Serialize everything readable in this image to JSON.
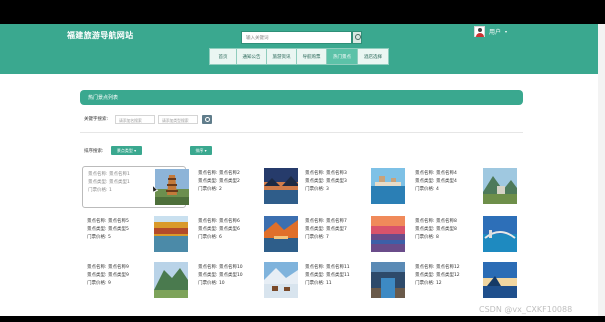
{
  "header": {
    "site_title": "福建旅游导航网站",
    "search_placeholder": "输入关键词",
    "user_name": "用户",
    "user_caret": "▾"
  },
  "nav": [
    {
      "label": "首页",
      "active": false,
      "w": 27
    },
    {
      "label": "通知公告",
      "active": false,
      "w": 30
    },
    {
      "label": "旅游资讯",
      "active": false,
      "w": 30
    },
    {
      "label": "导航购票",
      "active": false,
      "w": 30
    },
    {
      "label": "热门景点",
      "active": true,
      "w": 31
    },
    {
      "label": "酒店选择",
      "active": false,
      "w": 30
    }
  ],
  "panel": {
    "title": "热门景点列表",
    "keyword_label": "关键字搜索:",
    "name_placeholder": "请添加名搜索",
    "type_placeholder": "请添加类型搜索",
    "sort_label": "排序搜索:",
    "sort_type_button": "景点类型 ▾",
    "sort_button": "排序 ▾"
  },
  "cards": [
    {
      "name": "景点名称: 景点名称1",
      "type": "景点类型: 景点类型1",
      "price": "门票价格: 1",
      "selected": true,
      "image": "pagoda-landscape"
    },
    {
      "name": "景点名称: 景点名称2",
      "type": "景点类型: 景点类型2",
      "price": "门票价格: 2",
      "selected": false,
      "image": "lake-dusk"
    },
    {
      "name": "景点名称: 景点名称3",
      "type": "景点类型: 景点类型3",
      "price": "门票价格: 3",
      "selected": false,
      "image": "ocean-pier"
    },
    {
      "name": "景点名称: 景点名称4",
      "type": "景点类型: 景点类型4",
      "price": "门票价格: 4",
      "selected": false,
      "image": "mountain-forest"
    },
    {
      "name": "景点名称: 景点名称5",
      "type": "景点类型: 景点类型5",
      "price": "门票价格: 5",
      "selected": false,
      "image": "autumn-lake"
    },
    {
      "name": "景点名称: 景点名称6",
      "type": "景点类型: 景点类型6",
      "price": "门票价格: 6",
      "selected": false,
      "image": "autumn-river"
    },
    {
      "name": "景点名称: 景点名称7",
      "type": "景点类型: 景点类型7",
      "price": "门票价格: 7",
      "selected": false,
      "image": "sunset-sea"
    },
    {
      "name": "景点名称: 景点名称8",
      "type": "景点类型: 景点类型8",
      "price": "门票价格: 8",
      "selected": false,
      "image": "harbor-bridge"
    },
    {
      "name": "景点名称: 景点名称9",
      "type": "景点类型: 景点类型9",
      "price": "门票价格: 9",
      "selected": false,
      "image": "green-mountain"
    },
    {
      "name": "景点名称: 景点名称10",
      "type": "景点类型: 景点类型10",
      "price": "门票价格: 10",
      "selected": false,
      "image": "snow-village"
    },
    {
      "name": "景点名称: 景点名称11",
      "type": "景点类型: 景点类型11",
      "price": "门票价格: 11",
      "selected": false,
      "image": "canyon-river"
    },
    {
      "name": "景点名称: 景点名称12",
      "type": "景点类型: 景点类型12",
      "price": "门票价格: 12",
      "selected": false,
      "image": "sky-lake"
    }
  ],
  "watermark": "CSDN @vx_CXKF10088"
}
